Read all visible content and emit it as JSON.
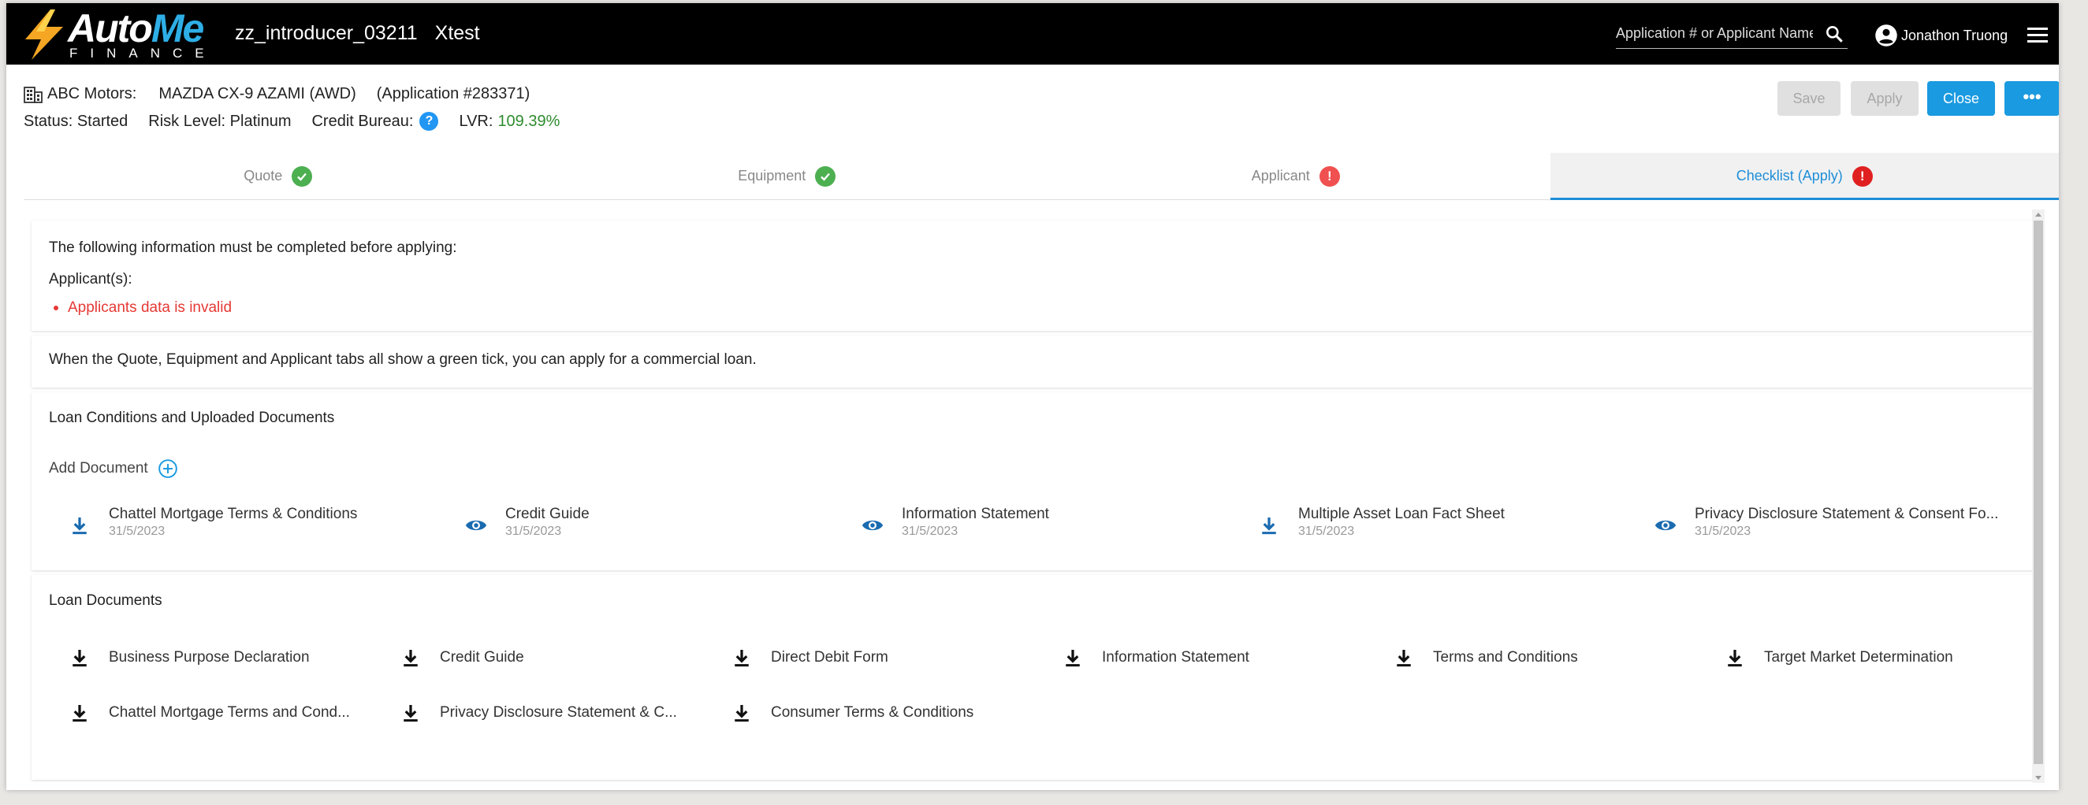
{
  "header": {
    "logo_main": "Auto",
    "logo_accent": "Me",
    "logo_sub": "FINANCE",
    "title": "zz_introducer_03211",
    "subtitle": "Xtest",
    "search_placeholder": "Application # or Applicant Name",
    "user_name": "Jonathon Truong"
  },
  "info": {
    "dealer": "ABC Motors:",
    "vehicle": "MAZDA CX-9 AZAMI (AWD)",
    "application": "(Application #283371)",
    "status": "Status: Started",
    "risk": "Risk Level: Platinum",
    "credit_bureau": "Credit Bureau:",
    "credit_bureau_icon": "?",
    "lvr_label": "LVR:",
    "lvr_value": "109.39%"
  },
  "actions": {
    "save": "Save",
    "apply": "Apply",
    "close": "Close",
    "more": "•••"
  },
  "tabs": [
    {
      "label": "Quote",
      "state": "ok"
    },
    {
      "label": "Equipment",
      "state": "ok"
    },
    {
      "label": "Applicant",
      "state": "error"
    },
    {
      "label": "Checklist (Apply)",
      "state": "error",
      "active": true
    }
  ],
  "tab_error_glyph": "!",
  "checklist": {
    "intro": "The following information must be completed before applying:",
    "applicants_heading": "Applicant(s):",
    "applicants_error": "Applicants data is invalid",
    "tick_message": "When the Quote, Equipment and Applicant tabs all show a green tick, you can apply for a commercial loan."
  },
  "conditions": {
    "heading": "Loan Conditions and Uploaded Documents",
    "add_document": "Add Document",
    "docs": [
      {
        "name": "Chattel Mortgage Terms & Conditions",
        "date": "31/5/2023",
        "icon": "download-icon"
      },
      {
        "name": "Credit Guide",
        "date": "31/5/2023",
        "icon": "eye-icon"
      },
      {
        "name": "Information Statement",
        "date": "31/5/2023",
        "icon": "eye-icon"
      },
      {
        "name": "Multiple Asset Loan Fact Sheet",
        "date": "31/5/2023",
        "icon": "download-icon"
      },
      {
        "name": "Privacy Disclosure Statement & Consent Fo...",
        "date": "31/5/2023",
        "icon": "eye-icon"
      }
    ]
  },
  "loan_documents": {
    "heading": "Loan Documents",
    "docs": [
      "Business Purpose Declaration",
      "Credit Guide",
      "Direct Debit Form",
      "Information Statement",
      "Terms and Conditions",
      "Target Market Determination",
      "Chattel Mortgage Terms and Cond...",
      "Privacy Disclosure Statement & C...",
      "Consumer Terms & Conditions"
    ]
  },
  "colors": {
    "primary": "#1a9ae0",
    "success": "#4caf50",
    "error": "#e53935",
    "lvr": "#2e8b2e"
  }
}
